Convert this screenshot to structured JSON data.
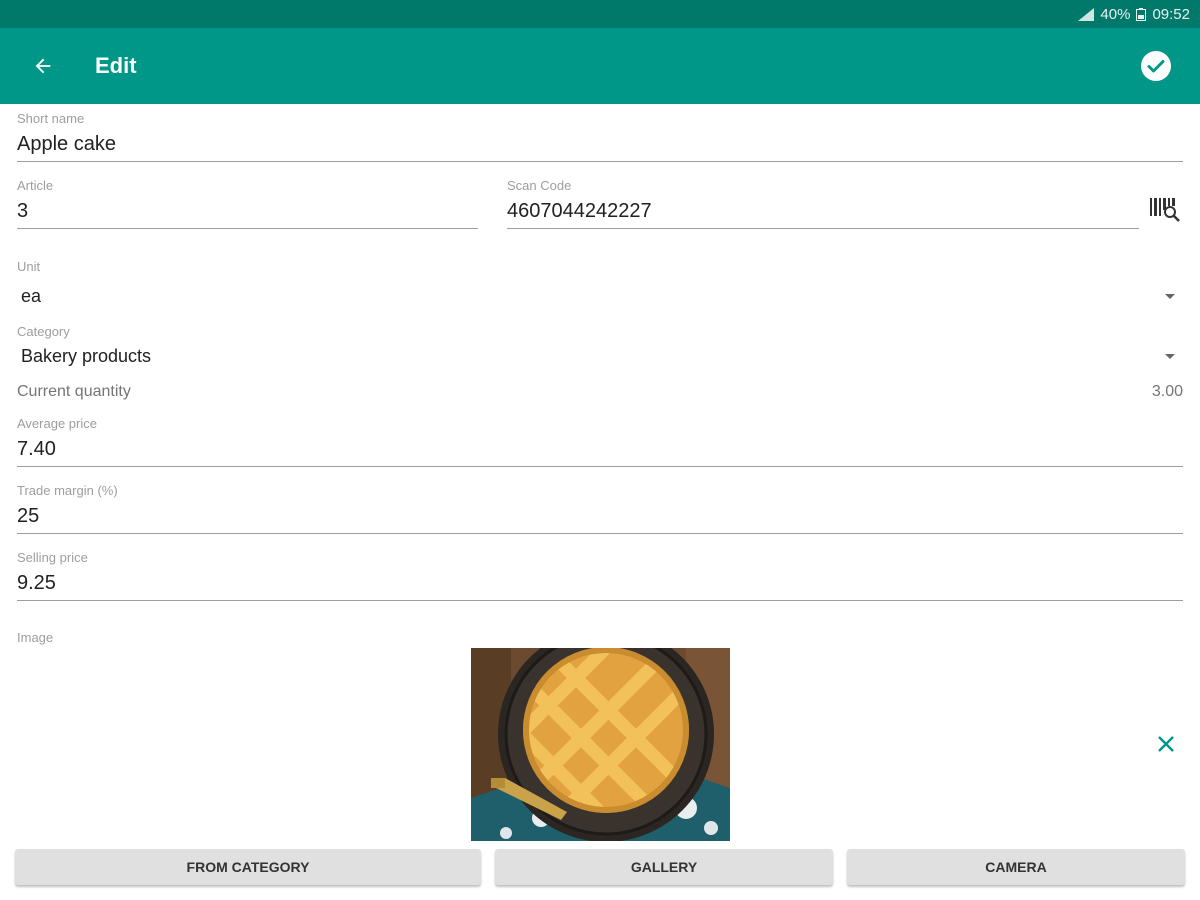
{
  "status_bar": {
    "battery": "40%",
    "time": "09:52"
  },
  "app_bar": {
    "title": "Edit"
  },
  "form": {
    "short_name": {
      "label": "Short name",
      "value": "Apple cake"
    },
    "article": {
      "label": "Article",
      "value": "3"
    },
    "scan_code": {
      "label": "Scan Code",
      "value": "4607044242227"
    },
    "unit": {
      "label": "Unit",
      "value": "ea"
    },
    "category": {
      "label": "Category",
      "value": "Bakery products"
    },
    "current_quantity": {
      "label": "Current quantity",
      "value": "3.00"
    },
    "average_price": {
      "label": "Average price",
      "value": "7.40"
    },
    "trade_margin": {
      "label": "Trade margin (%)",
      "value": "25"
    },
    "selling_price": {
      "label": "Selling price",
      "value": "9.25"
    },
    "image": {
      "label": "Image"
    }
  },
  "buttons": {
    "from_category": "FROM CATEGORY",
    "gallery": "GALLERY",
    "camera": "CAMERA"
  },
  "icons": {
    "back": "arrow-back-icon",
    "save": "check-circle-icon",
    "barcode": "barcode-search-icon",
    "clear": "close-icon"
  },
  "colors": {
    "primary": "#009688",
    "primary_dark": "#00796b"
  }
}
